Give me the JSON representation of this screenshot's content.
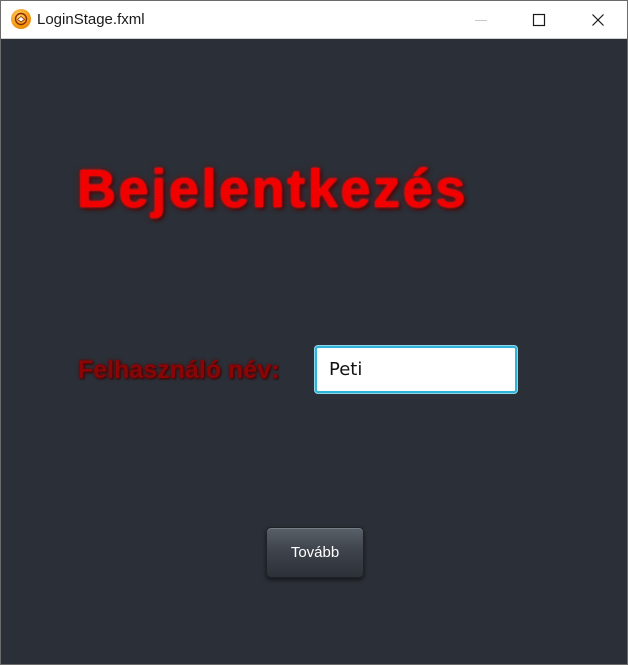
{
  "window": {
    "title": "LoginStage.fxml",
    "app_icon": "javafx-app-icon",
    "controls": {
      "minimize_icon": "minimize-icon",
      "maximize_icon": "maximize-icon",
      "close_icon": "close-icon"
    }
  },
  "login": {
    "heading": "Bejelentkezés",
    "username_label": "Felhasználó név:",
    "username_value": "Peti",
    "next_button_label": "Tovább"
  },
  "colors": {
    "background": "#2b2f37",
    "heading_red": "#f20000",
    "label_red": "#8a0606",
    "input_focus_border": "#2fb3d6",
    "titlebar": "#ffffff"
  }
}
